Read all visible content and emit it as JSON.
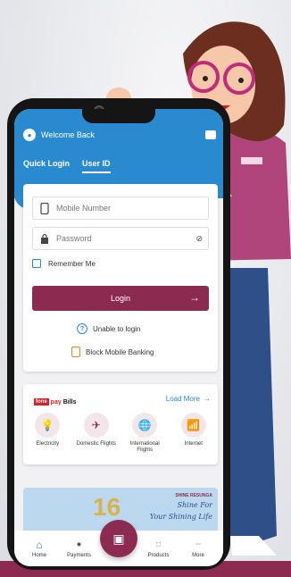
{
  "colors": {
    "primary": "#2a8ad0",
    "accent": "#8a2b4f",
    "bg": "#f1f1f3"
  },
  "header": {
    "welcome": "Welcome Back"
  },
  "tabs": [
    {
      "label": "Quick Login"
    },
    {
      "label": "User ID"
    }
  ],
  "login": {
    "mobile_placeholder": "Mobile Number",
    "password_placeholder": "Password",
    "remember_label": "Remember Me",
    "button_label": "Login",
    "unable_label": "Unable to login",
    "block_label": "Block Mobile Banking"
  },
  "bills": {
    "brand_1": "fone",
    "brand_2": "pay",
    "brand_3": "Bills",
    "load_more": "Load More",
    "items": [
      {
        "label": "Electricity",
        "icon": "bulb-icon"
      },
      {
        "label": "Domestic Flights",
        "icon": "plane-icon"
      },
      {
        "label": "International\nFlights",
        "icon": "globe-icon"
      },
      {
        "label": "Internet",
        "icon": "router-icon"
      }
    ]
  },
  "banner": {
    "brand": "SHINE RESUNGA",
    "slogan_1": "Shine For",
    "slogan_2": "Your Shining Life",
    "number": "16"
  },
  "bottom_nav": [
    {
      "label": "Home"
    },
    {
      "label": "Payments"
    },
    {
      "label": "Products"
    },
    {
      "label": "More"
    }
  ]
}
